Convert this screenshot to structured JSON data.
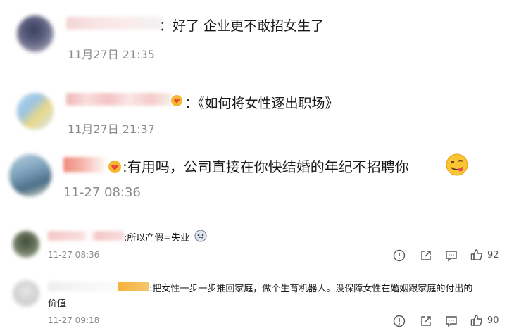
{
  "comments": [
    {
      "text": "：好了 企业更不敢招女生了",
      "time": "11月27日 21:35"
    },
    {
      "text": "：《如何将女性逐出职场》",
      "time": "11月27日 21:37"
    },
    {
      "text": ":有用吗，公司直接在你快结婚的年纪不招聘你",
      "time": "11-27 08:36"
    },
    {
      "text": ":所以产假=失业",
      "time": "11-27 08:36",
      "like_count": "92"
    },
    {
      "text_line1": ":把女性一步一步推回家庭，做个生育机器人。没保障女性在婚姻跟家庭的付出的",
      "text_line2": "价值",
      "time": "11-27 09:18",
      "like_count": "90"
    }
  ],
  "icons": [
    "report-icon",
    "share-icon",
    "comment-icon",
    "like-icon",
    "emoji-icon",
    "badge-icon"
  ]
}
